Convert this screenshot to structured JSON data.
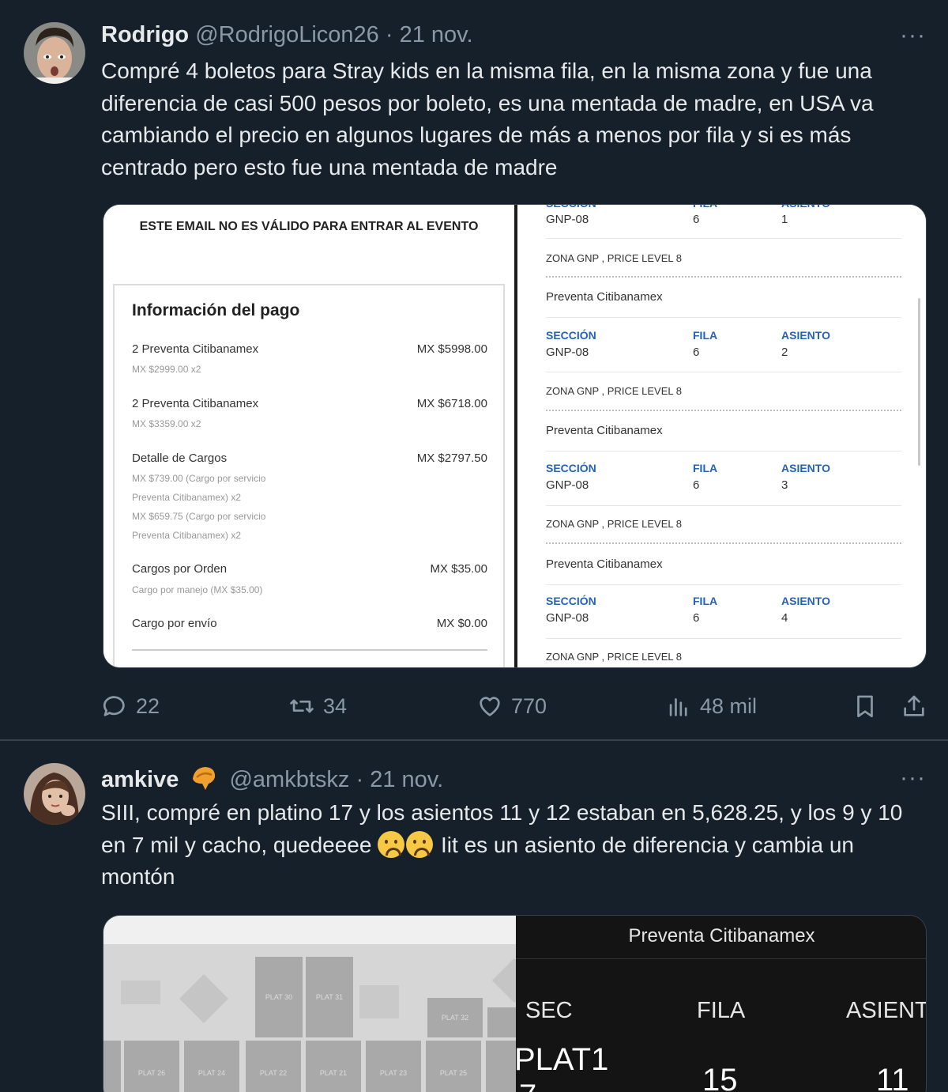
{
  "tweet1": {
    "name": "Rodrigo",
    "handle": "@RodrigoLicon26",
    "dot": "·",
    "date": "21 nov.",
    "more": "···",
    "text": "Compré 4 boletos para Stray kids en la misma fila, en la misma zona y fue una diferencia de casi 500 pesos por boleto, es una mentada de madre, en USA va cambiando el precio en algunos lugares de más a menos por fila y si es más centrado pero esto fue una mentada de madre",
    "media": {
      "invalid_notice": "ESTE EMAIL NO ES VÁLIDO PARA ENTRAR AL EVENTO",
      "payment": {
        "title": "Información del pago",
        "rows": [
          {
            "label": "2 Preventa Citibanamex",
            "amount": "MX $5998.00",
            "sub": [
              "MX $2999.00 x2"
            ]
          },
          {
            "label": "2 Preventa Citibanamex",
            "amount": "MX $6718.00",
            "sub": [
              "MX $3359.00 x2"
            ]
          },
          {
            "label": "Detalle de Cargos",
            "amount": "MX $2797.50",
            "sub": [
              "MX $739.00 (Cargo por servicio",
              "Preventa Citibanamex) x2",
              "MX $659.75 (Cargo por servicio",
              "Preventa Citibanamex) x2"
            ]
          },
          {
            "label": "Cargos por Orden",
            "amount": "MX $35.00",
            "sub": [
              "Cargo por manejo (MX $35.00)"
            ]
          },
          {
            "label": "Cargo por envío",
            "amount": "MX $0.00",
            "sub": []
          }
        ]
      },
      "tickets": {
        "labels": {
          "section": "SECCIÓN",
          "row": "FILA",
          "seat": "ASIENTO"
        },
        "zone": "ZONA GNP , PRICE LEVEL 8",
        "presale": "Preventa Citibanamex",
        "items": [
          {
            "section": "GNP-08",
            "row": "6",
            "seat": "1"
          },
          {
            "section": "GNP-08",
            "row": "6",
            "seat": "2"
          },
          {
            "section": "GNP-08",
            "row": "6",
            "seat": "3"
          },
          {
            "section": "GNP-08",
            "row": "6",
            "seat": "4"
          }
        ]
      }
    },
    "actions": {
      "replies": "22",
      "retweets": "34",
      "likes": "770",
      "views": "48 mil"
    }
  },
  "tweet2": {
    "name": "amkive",
    "handle": "@amkbtskz",
    "dot": "·",
    "date": "21 nov.",
    "more": "···",
    "text_part1": "SIII, compré en platino 17 y los asientos 11 y 12 estaban en 5,628.25, y los 9 y 10 en 7 mil y cacho, quedeeee",
    "text_part2": " Iit es un asiento de diferencia y cambia un montón",
    "media": {
      "map_blocks": [
        "PLAT 30",
        "PLAT 31",
        "PLAT 32",
        "PLAT 26",
        "PLAT 24",
        "PLAT 22",
        "PLAT 21",
        "PLAT 23",
        "PLAT 25"
      ],
      "ticket": {
        "title": "Preventa Citibanamex",
        "headers": {
          "section": "SEC",
          "row": "FILA",
          "seat": "ASIENT"
        },
        "values": {
          "section": "PLAT1",
          "section_cont": "7",
          "row": "15",
          "seat": "11"
        }
      }
    }
  }
}
